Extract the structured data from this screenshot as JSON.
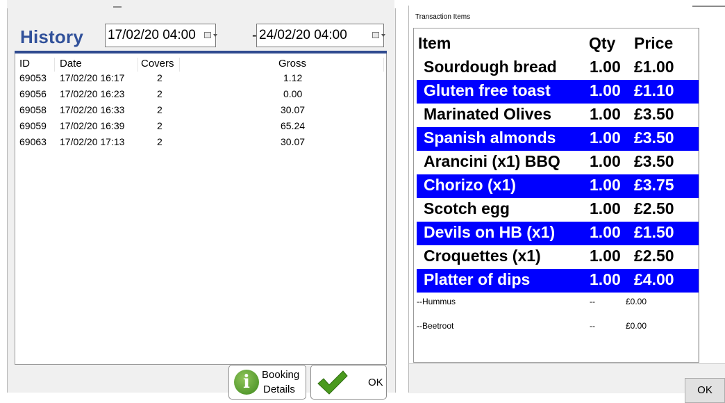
{
  "history": {
    "title": "History",
    "date_from": "17/02/20 04:00",
    "date_to": "24/02/20 04:00",
    "separator": "-",
    "columns": [
      "ID",
      "Date",
      "Covers",
      "Gross"
    ],
    "rows": [
      {
        "id": "69053",
        "date": "17/02/20 16:17",
        "covers": "2",
        "gross": "1.12"
      },
      {
        "id": "69056",
        "date": "17/02/20 16:23",
        "covers": "2",
        "gross": "0.00"
      },
      {
        "id": "69058",
        "date": "17/02/20 16:33",
        "covers": "2",
        "gross": "30.07"
      },
      {
        "id": "69059",
        "date": "17/02/20 16:39",
        "covers": "2",
        "gross": "65.24"
      },
      {
        "id": "69063",
        "date": "17/02/20 17:13",
        "covers": "2",
        "gross": "30.07"
      }
    ],
    "booking_button": {
      "line1": "Booking",
      "line2": "Details",
      "icon_glyph": "i"
    },
    "ok_label": "OK"
  },
  "transaction": {
    "title": "Transaction Items",
    "columns": [
      "Item",
      "Qty",
      "Price"
    ],
    "items": [
      {
        "name": "Sourdough bread",
        "qty": "1.00",
        "price": "£1.00"
      },
      {
        "name": "Gluten free toast",
        "qty": "1.00",
        "price": "£1.10"
      },
      {
        "name": "Marinated Olives",
        "qty": "1.00",
        "price": "£3.50"
      },
      {
        "name": "Spanish almonds",
        "qty": "1.00",
        "price": "£3.50"
      },
      {
        "name": "Arancini (x1) BBQ",
        "qty": "1.00",
        "price": "£3.50"
      },
      {
        "name": "Chorizo (x1)",
        "qty": "1.00",
        "price": "£3.75"
      },
      {
        "name": "Scotch egg",
        "qty": "1.00",
        "price": "£2.50"
      },
      {
        "name": "Devils on HB (x1)",
        "qty": "1.00",
        "price": "£1.50"
      },
      {
        "name": "Croquettes (x1)",
        "qty": "1.00",
        "price": "£2.50"
      },
      {
        "name": "Platter of dips",
        "qty": "1.00",
        "price": "£4.00"
      }
    ],
    "modifiers": [
      {
        "name": "--Hummus",
        "qty": "--",
        "price": "£0.00"
      },
      {
        "name": "--Beetroot",
        "qty": "--",
        "price": "£0.00"
      }
    ],
    "ok_label": "OK"
  },
  "colors": {
    "highlight": "#0000ff",
    "title_blue": "#31519a",
    "header_line": "#2f4a8f",
    "check_green": "#4a9a1e"
  }
}
